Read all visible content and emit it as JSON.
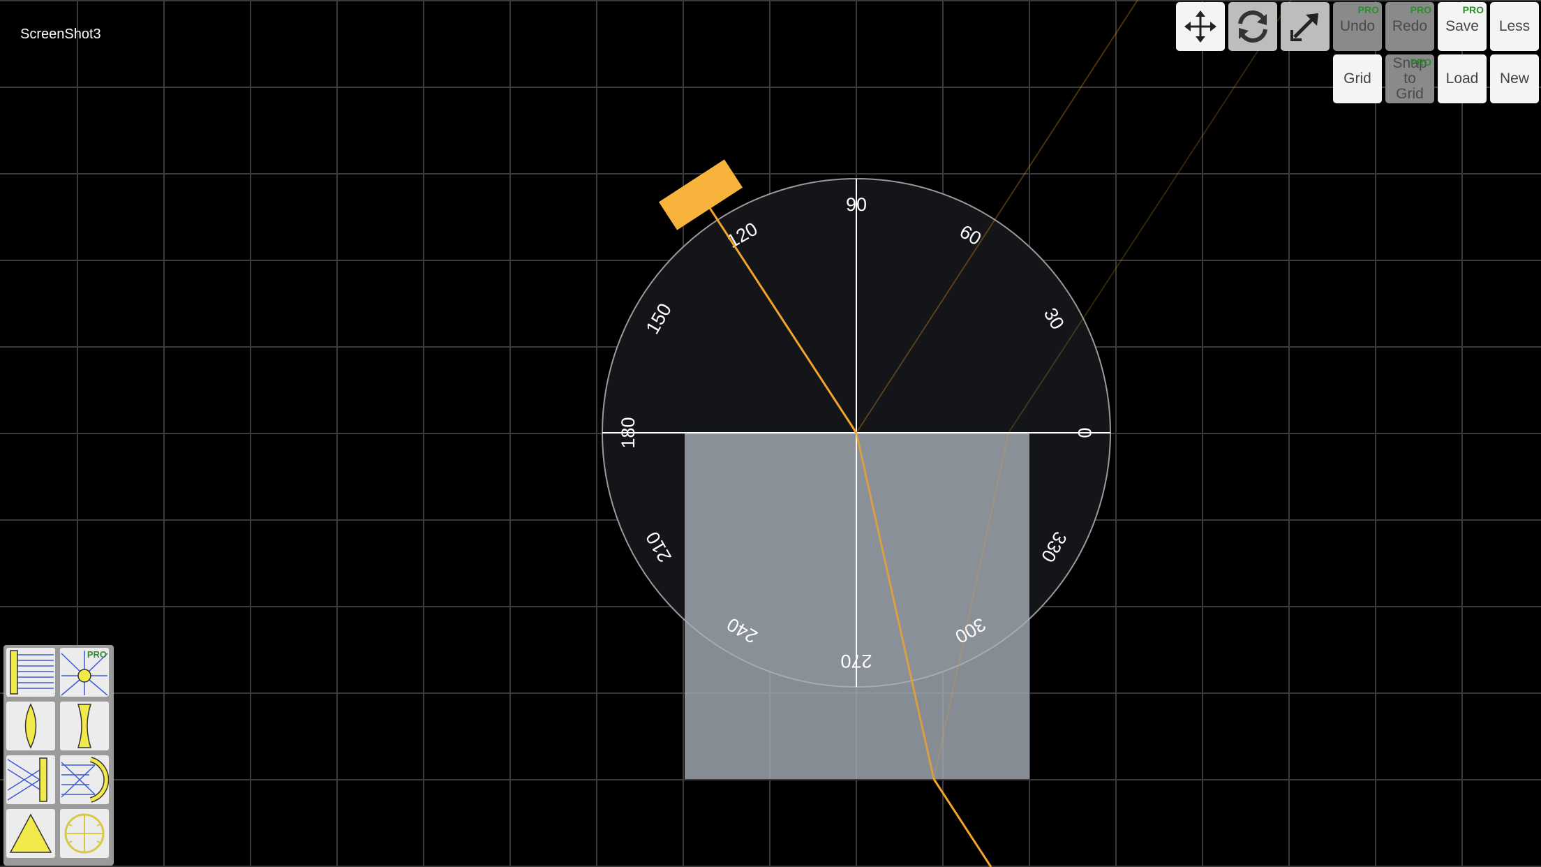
{
  "app": {
    "title": "ScreenShot3"
  },
  "toolbar": {
    "row1": [
      {
        "id": "move",
        "icon": "move-arrows-icon",
        "label": "",
        "disabled": false
      },
      {
        "id": "rotate",
        "icon": "rotate-arrows-icon",
        "label": "",
        "disabled": false
      },
      {
        "id": "resize",
        "icon": "resize-arrow-icon",
        "label": "",
        "disabled": false
      },
      {
        "id": "undo",
        "label": "Undo",
        "badge": "PRO",
        "disabled": true
      },
      {
        "id": "redo",
        "label": "Redo",
        "badge": "PRO",
        "disabled": true
      },
      {
        "id": "save",
        "label": "Save",
        "badge": "PRO",
        "disabled": false
      },
      {
        "id": "less",
        "label": "Less",
        "disabled": false
      }
    ],
    "row2": [
      {
        "id": "grid",
        "label": "Grid",
        "disabled": false
      },
      {
        "id": "snap",
        "label": "Snap to Grid",
        "badge": "PRO",
        "disabled": true
      },
      {
        "id": "load",
        "label": "Load",
        "disabled": false
      },
      {
        "id": "new",
        "label": "New",
        "disabled": false
      }
    ]
  },
  "protractor": {
    "angle_labels": [
      "0",
      "30",
      "60",
      "90",
      "120",
      "150",
      "180",
      "210",
      "240",
      "270",
      "300",
      "330"
    ]
  },
  "tools_palette": {
    "items": [
      {
        "icon": "ray-box-icon",
        "badge": ""
      },
      {
        "icon": "point-source-icon",
        "badge": "PRO"
      },
      {
        "icon": "convex-lens-icon",
        "badge": ""
      },
      {
        "icon": "concave-lens-icon",
        "badge": ""
      },
      {
        "icon": "flat-mirror-icon",
        "badge": ""
      },
      {
        "icon": "curved-mirror-icon",
        "badge": ""
      },
      {
        "icon": "prism-icon",
        "badge": ""
      },
      {
        "icon": "protractor-icon",
        "badge": ""
      }
    ]
  },
  "colors": {
    "background": "#000000",
    "grid": "#3a3a3a",
    "beam": "#f4a42a",
    "laser_body": "#f8b33c",
    "block": "#a8afb8",
    "protractor": "#131519",
    "tool_yellow": "#f2e94a",
    "tool_blue": "#3a5ad8",
    "pro_badge": "#2e8b2e"
  }
}
